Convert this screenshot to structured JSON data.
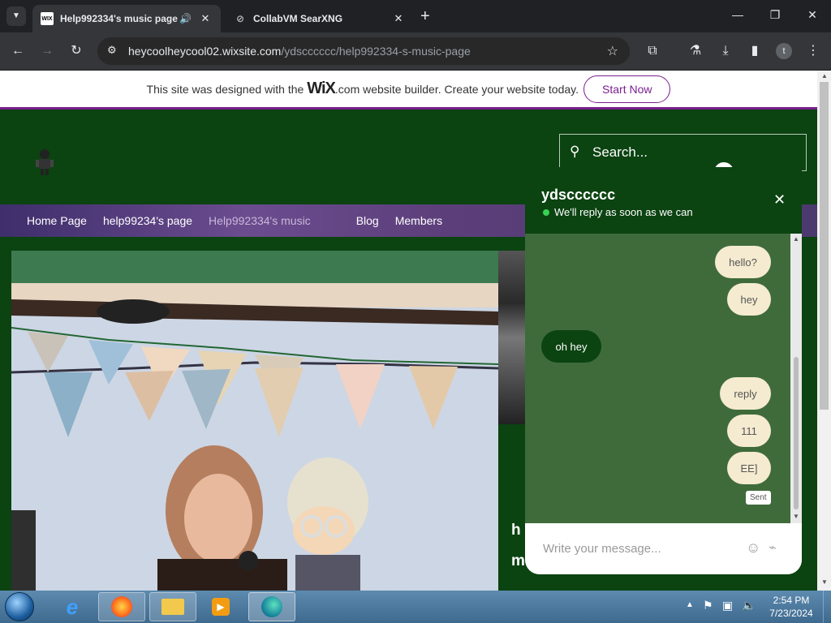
{
  "browser": {
    "tabs": [
      {
        "favicon": "WIX",
        "title": "Help992334's music page |"
      },
      {
        "favicon": "",
        "title": "CollabVM SearXNG"
      }
    ],
    "url_host": "heycoolheycool02.wixsite.com",
    "url_path": "/ydscccccc/help992334-s-music-page"
  },
  "banner": {
    "text_before": "This site was designed with the",
    "wix": "WiX",
    "text_after": ".com website builder. Create your website today.",
    "button": "Start Now"
  },
  "site": {
    "search_placeholder": "Search...",
    "nav": [
      "Home Page",
      "help99234's page",
      "Help992334's music",
      "Blog",
      "Members"
    ],
    "side_text_1": "h",
    "side_text_2": "m"
  },
  "chat": {
    "name": "ydscccccc",
    "status": "We'll reply as soon as we can",
    "messages": [
      {
        "dir": "out",
        "text": "hello?"
      },
      {
        "dir": "out",
        "text": "hey"
      },
      {
        "dir": "in",
        "text": "oh hey"
      },
      {
        "dir": "out",
        "text": "reply"
      },
      {
        "dir": "out",
        "text": "111"
      },
      {
        "dir": "out",
        "text": "EE]"
      }
    ],
    "sent_label": "Sent",
    "input_placeholder": "Write your message..."
  },
  "taskbar": {
    "time": "2:54 PM",
    "date": "7/23/2024"
  },
  "colors": {
    "site_bg": "#0b4311",
    "chat_area": "#3f6b3b",
    "bubble_out": "#f5ebd0",
    "wix_accent": "#7a1f8f"
  }
}
